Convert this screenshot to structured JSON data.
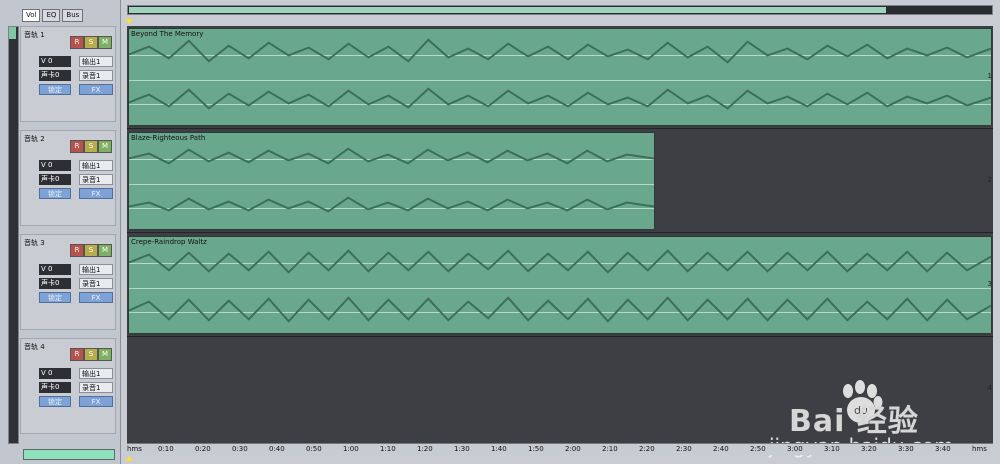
{
  "left_panel": {
    "tabs": [
      "Vol",
      "EQ",
      "Bus"
    ],
    "tracks": [
      {
        "name": "音轨 1",
        "volume": "V 0",
        "output": "输出1",
        "input": "声卡0",
        "mode": "录音1",
        "fx": "FX",
        "lock": "锁定"
      },
      {
        "name": "音轨 2",
        "volume": "V 0",
        "output": "输出1",
        "input": "声卡0",
        "mode": "录音1",
        "fx": "FX",
        "lock": "锁定"
      },
      {
        "name": "音轨 3",
        "volume": "V 0",
        "output": "输出1",
        "input": "声卡0",
        "mode": "录音1",
        "fx": "FX",
        "lock": "锁定"
      },
      {
        "name": "音轨 4",
        "volume": "V 0",
        "output": "输出1",
        "input": "声卡0",
        "mode": "录音1",
        "fx": "FX",
        "lock": "锁定"
      }
    ],
    "buttons": {
      "r": "R",
      "s": "S",
      "m": "M"
    }
  },
  "timeline": {
    "clips": [
      {
        "title": "Beyond The Memory"
      },
      {
        "title": "Blaze-Righteous Path"
      },
      {
        "title": "Crepe-Raindrop Waltz"
      }
    ],
    "ruler_labels": [
      "hms",
      "0:10",
      "0:20",
      "0:30",
      "0:40",
      "0:50",
      "1:00",
      "1:10",
      "1:20",
      "1:30",
      "1:40",
      "1:50",
      "2:00",
      "2:10",
      "2:20",
      "2:30",
      "2:40",
      "2:50",
      "3:00",
      "3:10",
      "3:20",
      "3:30",
      "3:40",
      "hms"
    ],
    "lane_numbers": [
      "1",
      "2",
      "3",
      "4"
    ]
  },
  "watermark": {
    "brand": "Bai 经验",
    "url": "jingyan.baidu.com"
  },
  "colors": {
    "accent": "#6aa88e",
    "panel": "#c9ccd3",
    "timeline_bg": "#3d3f44",
    "playhead": "#ffde32"
  }
}
